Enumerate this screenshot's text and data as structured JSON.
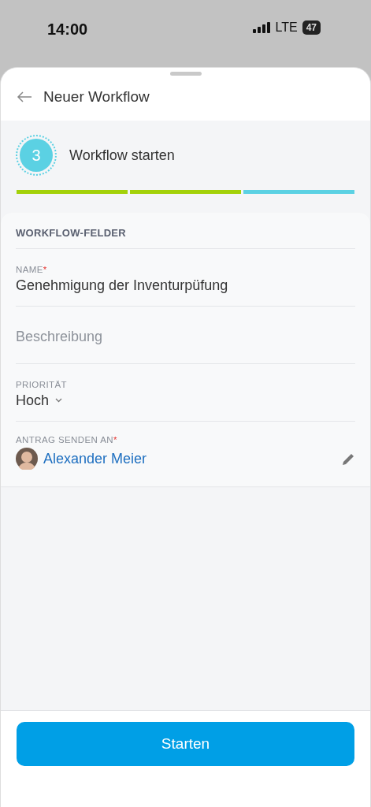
{
  "status_bar": {
    "time": "14:00",
    "network": "LTE",
    "battery": "47"
  },
  "header": {
    "title": "Neuer Workflow"
  },
  "step": {
    "number": "3",
    "title": "Workflow starten"
  },
  "progress": [
    {
      "completed": true
    },
    {
      "completed": true
    },
    {
      "completed": false
    }
  ],
  "section": {
    "title": "WORKFLOW-FELDER"
  },
  "fields": [
    {
      "kind": "text",
      "label": "NAME",
      "required_mark": "*",
      "value": "Genehmigung der Inventurpüfung"
    },
    {
      "kind": "text",
      "placeholder": "Beschreibung"
    },
    {
      "kind": "select",
      "label": "PRIORITÄT",
      "value": "Hoch"
    },
    {
      "kind": "user",
      "label": "ANTRAG SENDEN AN",
      "required_mark": "*",
      "value": "Alexander Meier"
    }
  ],
  "footer": {
    "button": "Starten"
  }
}
